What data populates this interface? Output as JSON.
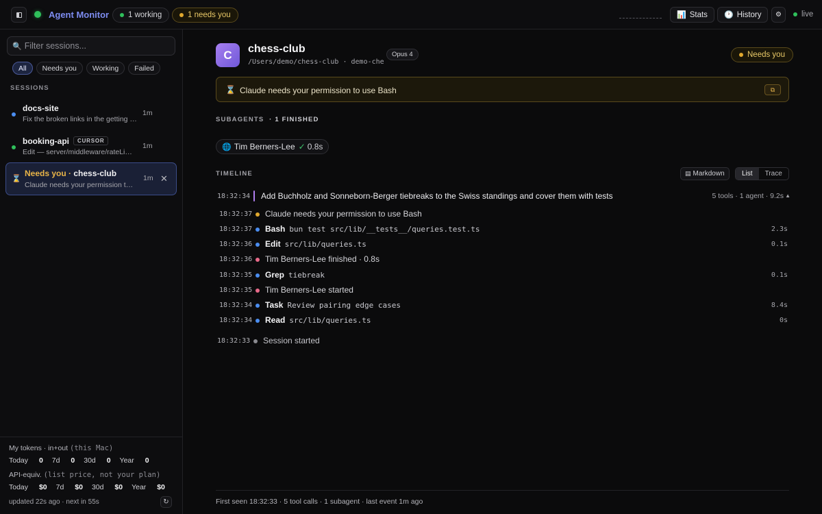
{
  "topbar": {
    "brand": "Agent Monitor",
    "working_pill": "1 working",
    "needs_pill": "1 needs you",
    "stats_label": "Stats",
    "history_label": "History",
    "live_label": "live"
  },
  "sidebar": {
    "search_placeholder": "Filter sessions...",
    "filters": [
      "All",
      "Needs you",
      "Working",
      "Failed"
    ],
    "sessions_heading": "SESSIONS",
    "sessions": [
      {
        "name": "docs-site",
        "subtitle": "Fix the broken links in the getting s...",
        "time": "1m",
        "status_color": "#4b8df0"
      },
      {
        "name": "booking-api",
        "tag": "CURSOR",
        "subtitle": "Edit — server/middleware/rateLimit...",
        "time": "1m",
        "status_color": "#2fbf5b"
      },
      {
        "prefix": "Needs you",
        "separator": " · ",
        "name": "chess-club",
        "subtitle": "Claude needs your permission to ...",
        "time": "1m"
      }
    ],
    "footer": {
      "tokens_label": "My tokens · in+out",
      "tokens_note": "(this Mac)",
      "tokens": [
        {
          "label": "Today",
          "value": "0"
        },
        {
          "label": "7d",
          "value": "0"
        },
        {
          "label": "30d",
          "value": "0"
        },
        {
          "label": "Year",
          "value": "0"
        }
      ],
      "api_label": "API-equiv.",
      "api_note": "(list price, not your plan)",
      "api": [
        {
          "label": "Today",
          "value": "$0"
        },
        {
          "label": "7d",
          "value": "$0"
        },
        {
          "label": "30d",
          "value": "$0"
        },
        {
          "label": "Year",
          "value": "$0"
        }
      ],
      "updated": "updated 22s ago · next in 55s"
    }
  },
  "main": {
    "avatar_letter": "C",
    "title": "chess-club",
    "path": "/Users/demo/chess-club · demo-che",
    "model": "Opus 4",
    "status_badge": "Needs you",
    "permission_text": "Claude needs your permission to use Bash",
    "subagents_heading": "SUBAGENTS",
    "subagents_count": "· 1 FINISHED",
    "subagent": {
      "name": "Tim Berners-Lee",
      "duration": "0.8s"
    },
    "timeline_heading": "TIMELINE",
    "markdown_label": "Markdown",
    "view_list": "List",
    "view_trace": "Trace",
    "prompt": {
      "time": "18:32:34",
      "text": "Add Buchholz and Sonneborn-Berger tiebreaks to the Swiss standings and cover them with tests",
      "meta": "5 tools · 1 agent · 9.2s"
    },
    "events": [
      {
        "time": "18:32:37",
        "text": "Claude needs your permission to use Bash",
        "color": "yellow"
      },
      {
        "time": "18:32:37",
        "tool": "Bash",
        "arg": "bun test src/lib/__tests__/queries.test.ts",
        "dur": "2.3s",
        "color": "blue"
      },
      {
        "time": "18:32:36",
        "tool": "Edit",
        "arg": "src/lib/queries.ts",
        "dur": "0.1s",
        "color": "blue"
      },
      {
        "time": "18:32:36",
        "text": "Tim Berners-Lee finished · 0.8s",
        "color": "pink"
      },
      {
        "time": "18:32:35",
        "tool": "Grep",
        "arg": "tiebreak",
        "dur": "0.1s",
        "color": "blue"
      },
      {
        "time": "18:32:35",
        "text": "Tim Berners-Lee started",
        "color": "pink"
      },
      {
        "time": "18:32:34",
        "tool": "Task",
        "arg": "Review pairing edge cases",
        "dur": "8.4s",
        "color": "blue"
      },
      {
        "time": "18:32:34",
        "tool": "Read",
        "arg": "src/lib/queries.ts",
        "dur": "0s",
        "color": "blue"
      }
    ],
    "session_start": {
      "time": "18:32:33",
      "text": "Session started"
    },
    "footer": "First seen 18:32:33 · 5 tool calls · 1 subagent · last event 1m ago"
  }
}
